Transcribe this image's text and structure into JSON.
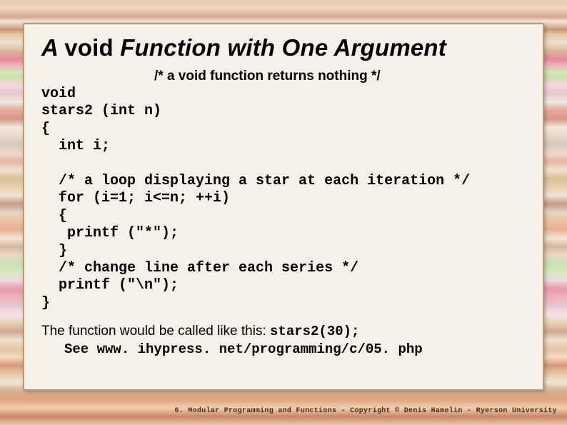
{
  "title_part1": "A ",
  "title_part2": "void ",
  "title_part3": "Function with One Argument",
  "comment_top": "/* a void function returns nothing */",
  "code": "void\nstars2 (int n)\n{\n  int i;\n\n  /* a loop displaying a star at each iteration */\n  for (i=1; i<=n; ++i)\n  {\n   printf (\"*\");\n  }\n  /* change line after each series */\n  printf (\"\\n\");\n}",
  "call_text_pre": "The function would be called like this: ",
  "call_code": "stars2(30);",
  "see_line": "See www. ihypress. net/programming/c/05. php",
  "footer": "6. Modular Programming and Functions - Copyright © Denis Hamelin - Ryerson University"
}
